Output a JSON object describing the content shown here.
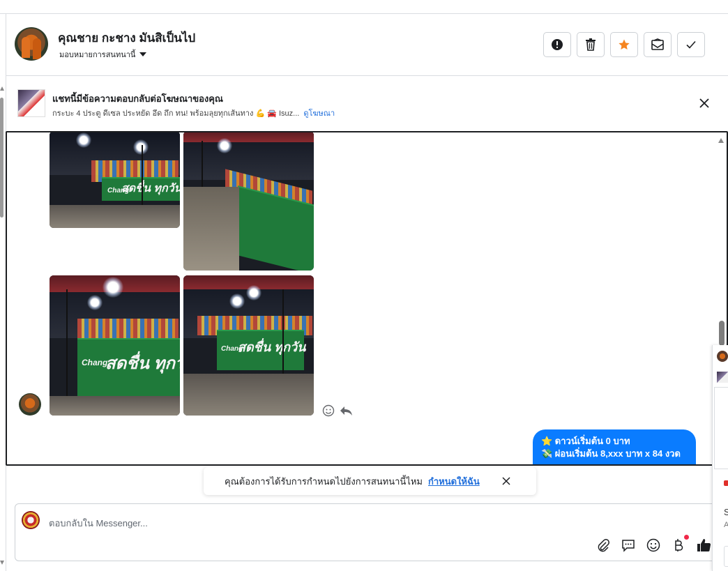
{
  "header": {
    "contact_name": "คุณชาย กะชาง มันสิเป็นไป",
    "assign_label": "มอบหมายการสนทนานี้",
    "buttons": {
      "spam": "spam-icon",
      "delete": "trash-icon",
      "star": "star-icon",
      "unread": "mail-icon",
      "done": "check-icon"
    },
    "star_color": "#f5841f"
  },
  "ad_banner": {
    "title": "แชทนี้มีข้อความตอบกลับต่อโฆษณาของคุณ",
    "ad_text": "กระบะ 4 ประตู ดีเซล ประหยัด อึด ถึก ทน! พร้อมลุยทุกเส้นทาง 💪 🚘 Isuz...",
    "view_ad_link": "ดูโฆษณา"
  },
  "thread": {
    "photos": [
      {
        "id": "photo-1",
        "banner_text": "สดชื่น ทุกวัน",
        "brand": "Chang"
      },
      {
        "id": "photo-2",
        "banner_text": "",
        "brand": ""
      },
      {
        "id": "photo-3",
        "banner_text": "สดชื่น ทุกวัน",
        "brand": "Chang"
      },
      {
        "id": "photo-4",
        "banner_text": "สดชื่น ทุกวัน",
        "brand": "Chang"
      }
    ],
    "outgoing_message": {
      "line1": "⭐ ดาวน์เริ่มต้น 0 บาท",
      "line2": "💸 ผ่อนเริ่มต้น 8,xxx บาท x 84 งวด"
    },
    "bubble_color": "#0a7cff"
  },
  "assign_prompt": {
    "text": "คุณต้องการได้รับการกำหนดไปยังการสนทนานี้ไหม",
    "link": "กำหนดให้ฉัน"
  },
  "composer": {
    "placeholder": "ตอบกลับใน Messenger...",
    "tools": [
      "paperclip-icon",
      "saved-reply-icon",
      "emoji-icon",
      "baht-icon",
      "like-icon"
    ]
  },
  "side_panel": {
    "letter_s": "S",
    "letter_a": "A"
  }
}
